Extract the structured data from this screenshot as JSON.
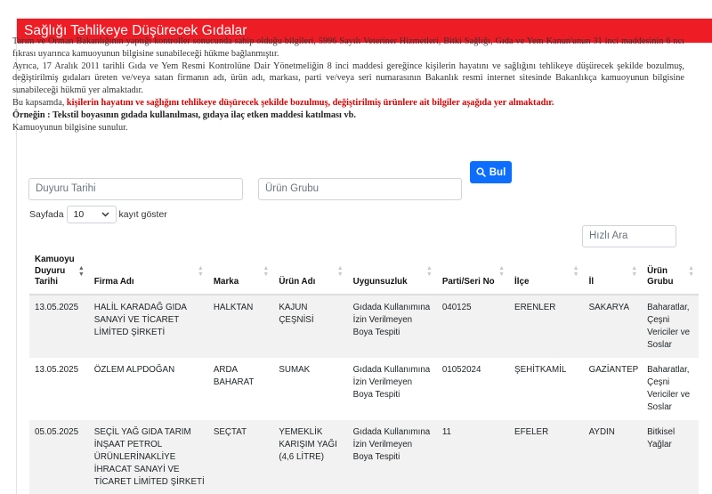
{
  "header": {
    "title": "Sağlığı Tehlikeye Düşürecek Gıdalar"
  },
  "intro": {
    "p1": "Tarım ve Orman Bakanlığının yaptığı kontroller sonucunda sahip olduğu bilgileri, 5996 Sayılı Veteriner Hizmetleri, Bitki Sağlığı, Gıda ve Yem Kanun'unun 31 inci maddesinin 6 ncı fıkrası uyarınca kamuoyunun bilgisine sunabileceği hükme bağlanmıştır.",
    "p2": "Ayrıca, 17 Aralık 2011 tarihli Gıda ve Yem Resmi Kontrolüne Dair Yönetmeliğin 8 inci maddesi gereğince kişilerin hayatını ve sağlığını tehlikeye düşürecek şekilde bozulmuş, değiştirilmiş gıdaları üreten ve/veya satan firmanın adı, ürün adı, markası, parti ve/veya seri numarasının Bakanlık resmi internet sitesinde Bakanlıkça kamuoyunun bilgisine sunabileceği hükmü yer almaktadır.",
    "p3_prefix": "Bu kapsamda, ",
    "p3_red": "kişilerin hayatını ve sağlığını tehlikeye düşürecek şekilde bozulmuş, değiştirilmiş ürünlere ait bilgiler aşağıda yer almaktadır.",
    "p4": "Örneğin : Tekstil boyasının gıdada kullanılması, gıdaya ilaç etken maddesi katılması vb.",
    "p5": "Kamuoyunun bilgisine sunulur."
  },
  "filters": {
    "date_placeholder": "Duyuru Tarihi",
    "group_placeholder": "Ürün Grubu",
    "search_button": "Bul"
  },
  "length": {
    "prefix": "Sayfada",
    "value": "10",
    "suffix": "kayıt göster"
  },
  "quick_search": {
    "placeholder": "Hızlı Ara"
  },
  "table": {
    "headers": [
      "Kamuoyu Duyuru Tarihi",
      "Firma Adı",
      "Marka",
      "Ürün Adı",
      "Uygunsuzluk",
      "Parti/Seri No",
      "İlçe",
      "İl",
      "Ürün Grubu"
    ],
    "rows": [
      [
        "13.05.2025",
        "HALİL KARADAĞ GIDA SANAYİ VE TİCARET LİMİTED ŞİRKETİ",
        "HALKTAN",
        "KAJUN ÇEŞNİSİ",
        "Gıdada Kullanımına İzin Verilmeyen Boya Tespiti",
        "040125",
        "ERENLER",
        "SAKARYA",
        "Baharatlar, Çeşni Vericiler ve Soslar"
      ],
      [
        "13.05.2025",
        "ÖZLEM ALPDOĞAN",
        "ARDA BAHARAT",
        "SUMAK",
        "Gıdada Kullanımına İzin Verilmeyen Boya Tespiti",
        "01052024",
        "ŞEHİTKAMİL",
        "GAZİANTEP",
        "Baharatlar, Çeşni Vericiler ve Soslar"
      ],
      [
        "05.05.2025",
        "SEÇİL YAĞ GIDA TARIM İNŞAAT PETROL ÜRÜNLERİNAKLİYE İHRACAT SANAYİ VE TİCARET LİMİTED ŞİRKETİ",
        "SEÇTAT",
        "YEMEKLİK KARIŞIM YAĞI (4,6 LİTRE)",
        "Gıdada Kullanımına İzin Verilmeyen Boya Tespiti",
        "11",
        "EFELER",
        "AYDIN",
        "Bitkisel Yağlar"
      ]
    ]
  },
  "colors": {
    "header_bg": "#ee1c25",
    "button_bg": "#0d6efd",
    "warning_text": "#d20000"
  }
}
